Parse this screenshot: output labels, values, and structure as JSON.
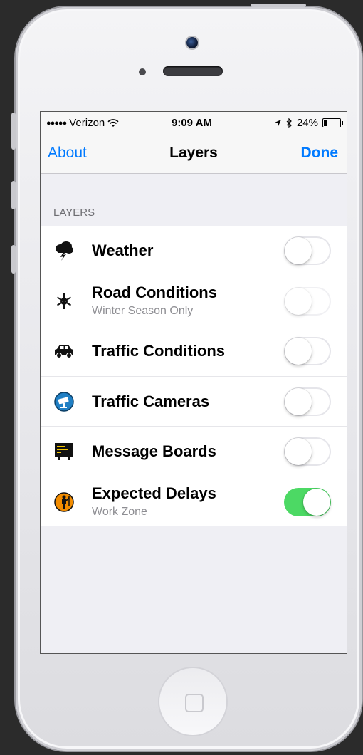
{
  "status_bar": {
    "signal_dots": "●●●●●",
    "carrier": "Verizon",
    "wifi_icon": "wifi-icon",
    "time": "9:09 AM",
    "location_icon": "location-arrow-icon",
    "bluetooth_icon": "bluetooth-icon",
    "battery_percent": "24%",
    "battery_level": 0.24
  },
  "nav": {
    "left_label": "About",
    "title": "Layers",
    "right_label": "Done",
    "accent_color": "#007aff"
  },
  "section": {
    "header": "LAYERS"
  },
  "layers": [
    {
      "title": "Weather",
      "subtitle": "",
      "icon": "storm-cloud-icon",
      "enabled": false
    },
    {
      "title": "Road Conditions",
      "subtitle": "Winter Season Only",
      "icon": "snowflake-icon",
      "enabled": false
    },
    {
      "title": "Traffic Conditions",
      "subtitle": "",
      "icon": "car-icon",
      "enabled": false
    },
    {
      "title": "Traffic Cameras",
      "subtitle": "",
      "icon": "camera-icon",
      "enabled": false
    },
    {
      "title": "Message Boards",
      "subtitle": "",
      "icon": "message-board-icon",
      "enabled": false
    },
    {
      "title": "Expected Delays",
      "subtitle": "Work Zone",
      "icon": "work-zone-icon",
      "enabled": true
    }
  ],
  "colors": {
    "toggle_on": "#4cd964",
    "subtitle_gray": "#8e8e93"
  }
}
